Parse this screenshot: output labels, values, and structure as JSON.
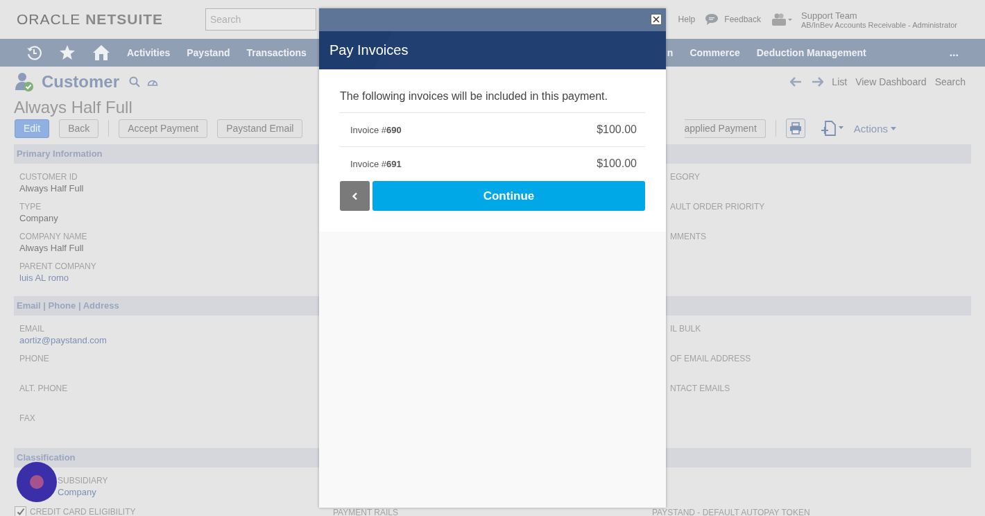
{
  "header": {
    "logo_left": "ORACLE",
    "logo_right": "NETSUITE",
    "search": {
      "placeholder": "Search"
    },
    "help": "Help",
    "feedback": "Feedback",
    "user": {
      "name": "Support Team",
      "role": "AB/InBev Accounts Receivable - Administrator"
    }
  },
  "nav": {
    "left": [
      "Activities",
      "Paystand",
      "Transactions"
    ],
    "right": [
      "n",
      "Commerce",
      "Deduction Management"
    ],
    "more": "..."
  },
  "record": {
    "type": "Customer",
    "name": "Always Half Full",
    "links": [
      "List",
      "View Dashboard",
      "Search"
    ]
  },
  "buttons": [
    {
      "label": "Edit",
      "primary": true
    },
    {
      "label": "Back",
      "primary": false
    },
    {
      "label": "Accept Payment",
      "primary": false
    },
    {
      "label": "Paystand Email",
      "primary": false
    }
  ],
  "right_buttons": [
    "applied Payment"
  ],
  "actions": "Actions",
  "sections": [
    {
      "title": "Primary Information",
      "left": [
        {
          "label": "CUSTOMER ID",
          "value": "Always Half Full",
          "kind": "text"
        },
        {
          "label": "TYPE",
          "value": "Company",
          "kind": "text"
        },
        {
          "label": "COMPANY NAME",
          "value": "Always Half Full",
          "kind": "text"
        },
        {
          "label": "PARENT COMPANY",
          "value": "luis AL romo",
          "kind": "link"
        }
      ],
      "right": [
        "EGORY",
        "AULT ORDER PRIORITY",
        "MMENTS"
      ]
    },
    {
      "title": "Email | Phone | Address",
      "left": [
        {
          "label": "EMAIL",
          "value": "aortiz@paystand.com",
          "kind": "link"
        },
        {
          "label": "PHONE"
        },
        {
          "label": "ALT. PHONE"
        },
        {
          "label": "FAX"
        }
      ],
      "right": [
        "IL BULK",
        "OF EMAIL ADDRESS",
        "NTACT EMAILS"
      ]
    },
    {
      "title": "Classification",
      "left": [
        {
          "label": "SUBSIDIARY",
          "value": "Company",
          "kind": "link"
        }
      ]
    }
  ],
  "bottom_row": {
    "checkbox": {
      "label": "CREDIT CARD ELIGIBILITY",
      "checked": true
    },
    "middle": "PAYMENT RAILS",
    "right": "PAYSTAND - DEFAULT AUTOPAY TOKEN"
  },
  "modal": {
    "title": "Pay Invoices",
    "message": "The following invoices will be included in this payment.",
    "invoices": [
      {
        "label": "Invoice #**690**",
        "amount": "$100.00"
      },
      {
        "label": "Invoice #**691**",
        "amount": "$100.00"
      }
    ],
    "continue": "Continue"
  }
}
